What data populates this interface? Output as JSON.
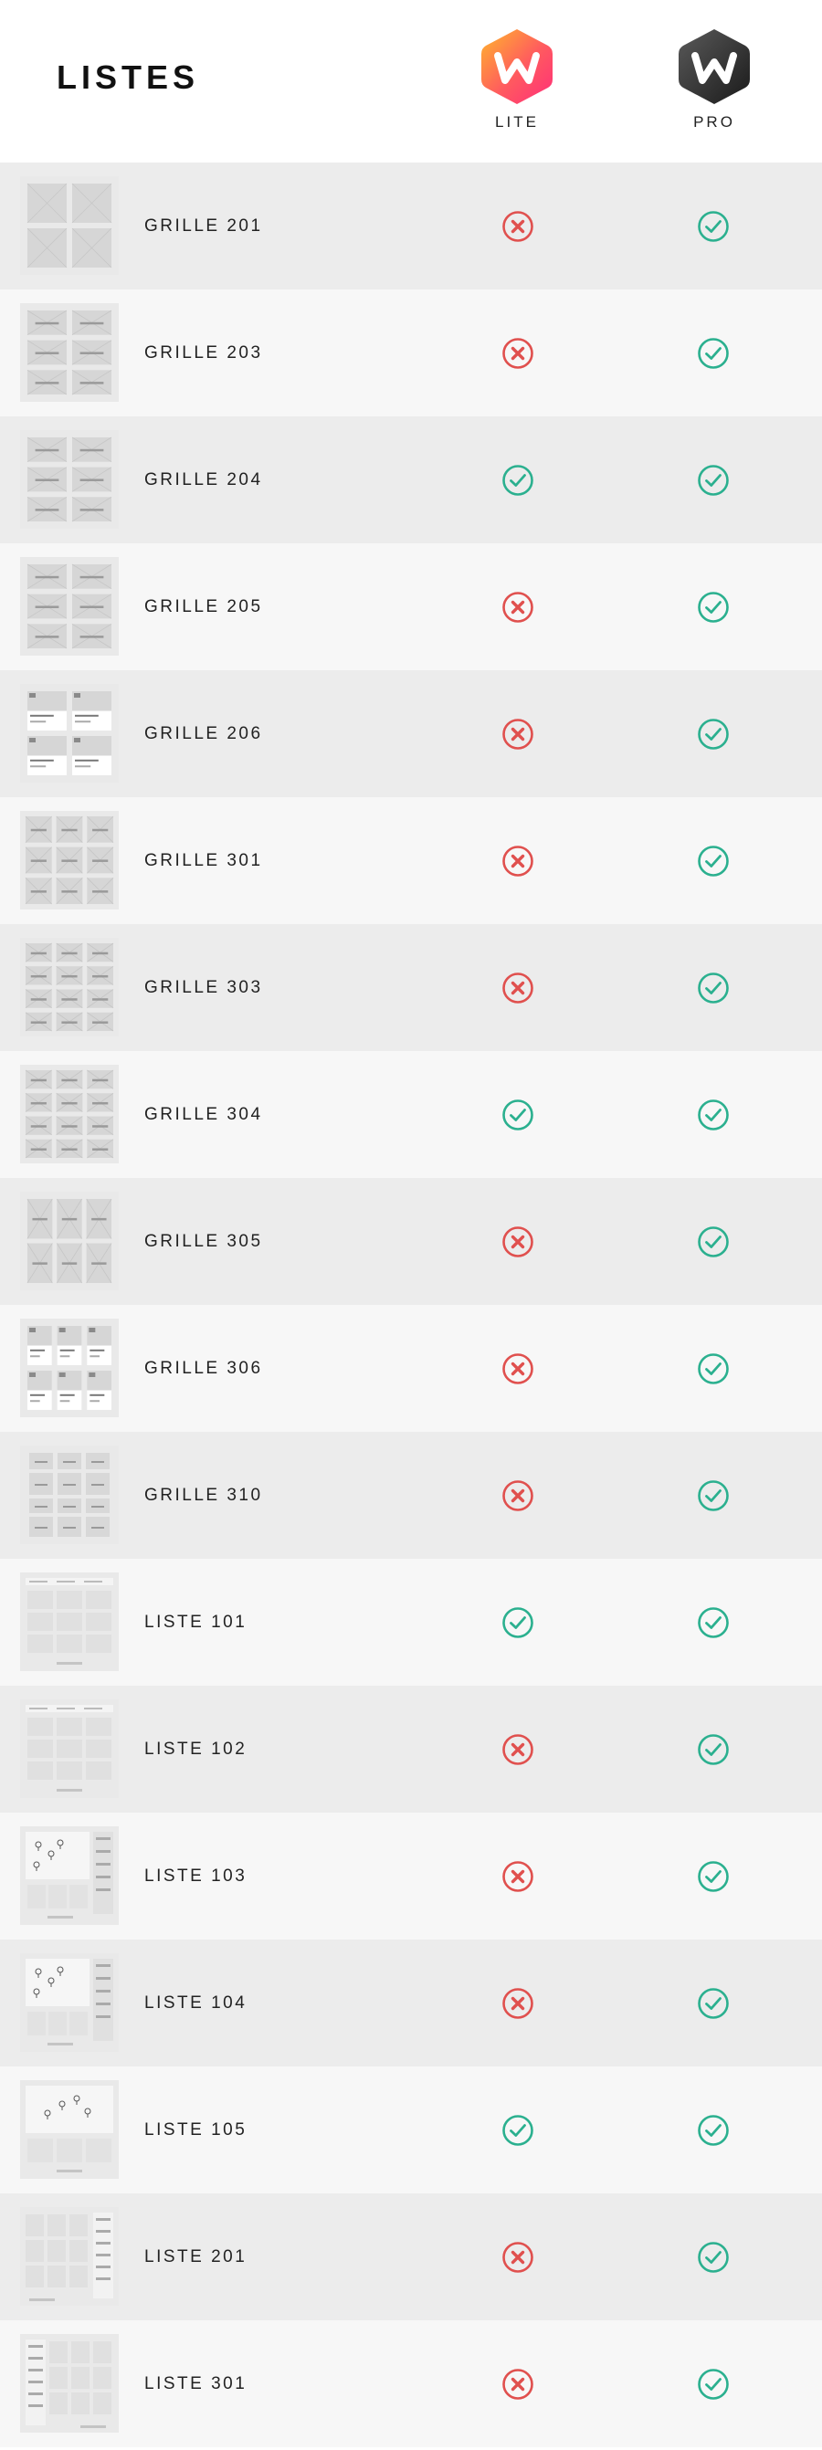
{
  "header": {
    "title": "LISTES",
    "plans": [
      {
        "label": "LITE",
        "icon": "w-logo-gradient-icon",
        "colors": [
          "#ff5a5f",
          "#ffae2b",
          "#ff2e7a"
        ]
      },
      {
        "label": "PRO",
        "icon": "w-logo-dark-icon",
        "colors": [
          "#555555",
          "#1a1a1a"
        ]
      }
    ]
  },
  "colors": {
    "check": "#2bb08f",
    "cross": "#e0504e",
    "row_odd": "#ececec",
    "row_even": "#f7f7f7"
  },
  "rows": [
    {
      "label": "GRILLE 201",
      "lite": false,
      "pro": true,
      "thumb": "grid-2x2"
    },
    {
      "label": "GRILLE 203",
      "lite": false,
      "pro": true,
      "thumb": "grid-2x3"
    },
    {
      "label": "GRILLE 204",
      "lite": true,
      "pro": true,
      "thumb": "grid-2x3"
    },
    {
      "label": "GRILLE 205",
      "lite": false,
      "pro": true,
      "thumb": "grid-2x3"
    },
    {
      "label": "GRILLE 206",
      "lite": false,
      "pro": true,
      "thumb": "grid-cards-2"
    },
    {
      "label": "GRILLE 301",
      "lite": false,
      "pro": true,
      "thumb": "grid-3x3"
    },
    {
      "label": "GRILLE 303",
      "lite": false,
      "pro": true,
      "thumb": "grid-3x4"
    },
    {
      "label": "GRILLE 304",
      "lite": true,
      "pro": true,
      "thumb": "grid-3x4"
    },
    {
      "label": "GRILLE 305",
      "lite": false,
      "pro": true,
      "thumb": "grid-3x2"
    },
    {
      "label": "GRILLE 306",
      "lite": false,
      "pro": true,
      "thumb": "grid-cards-3"
    },
    {
      "label": "GRILLE 310",
      "lite": false,
      "pro": true,
      "thumb": "grid-masonry"
    },
    {
      "label": "LISTE 101",
      "lite": true,
      "pro": true,
      "thumb": "list-filters"
    },
    {
      "label": "LISTE 102",
      "lite": false,
      "pro": true,
      "thumb": "list-filters"
    },
    {
      "label": "LISTE 103",
      "lite": false,
      "pro": true,
      "thumb": "list-map-side"
    },
    {
      "label": "LISTE 104",
      "lite": false,
      "pro": true,
      "thumb": "list-map-side"
    },
    {
      "label": "LISTE 105",
      "lite": true,
      "pro": true,
      "thumb": "list-map"
    },
    {
      "label": "LISTE 201",
      "lite": false,
      "pro": true,
      "thumb": "list-sidebar-right"
    },
    {
      "label": "LISTE 301",
      "lite": false,
      "pro": true,
      "thumb": "list-sidebar-left"
    }
  ]
}
